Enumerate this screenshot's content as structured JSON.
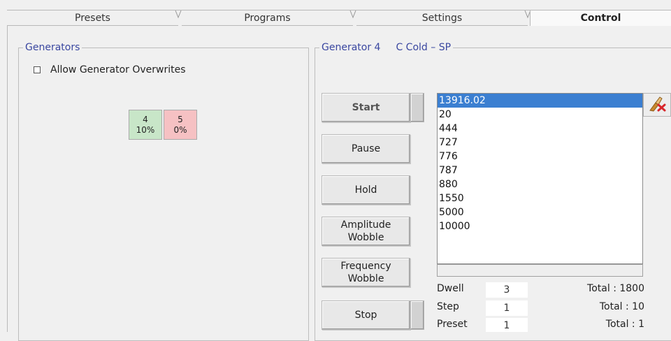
{
  "tabs": [
    {
      "label": "Presets"
    },
    {
      "label": "Programs"
    },
    {
      "label": "Settings"
    },
    {
      "label": "Control"
    }
  ],
  "generators_panel": {
    "title": "Generators",
    "allow_overwrites_label": "Allow Generator Overwrites",
    "allow_overwrites_checked": false,
    "chips": [
      {
        "number": "4",
        "percent": "10%",
        "color": "#c8e6c8"
      },
      {
        "number": "5",
        "percent": "0%",
        "color": "#f6c1c3"
      }
    ]
  },
  "generator_panel": {
    "title": "Generator 4",
    "program": "C Cold – SP"
  },
  "buttons": {
    "start": "Start",
    "pause": "Pause",
    "hold": "Hold",
    "amplitude_wobble_1": "Amplitude",
    "amplitude_wobble_2": "Wobble",
    "frequency_wobble_1": "Frequency",
    "frequency_wobble_2": "Wobble",
    "stop": "Stop"
  },
  "frequency_list": {
    "selected_index": 0,
    "items": [
      "13916.02",
      "20",
      "444",
      "727",
      "776",
      "787",
      "880",
      "1550",
      "5000",
      "10000"
    ]
  },
  "stats": {
    "dwell_label": "Dwell",
    "dwell_value": "3",
    "dwell_total": "Total : 1800",
    "step_label": "Step",
    "step_value": "1",
    "step_total": "Total : 10",
    "preset_label": "Preset",
    "preset_value": "1",
    "preset_total": "Total : 1"
  },
  "icons": {
    "clear_list": "eraser-delete-icon"
  },
  "colors": {
    "group_title": "#3a47a0",
    "selection": "#3b7fd1"
  }
}
